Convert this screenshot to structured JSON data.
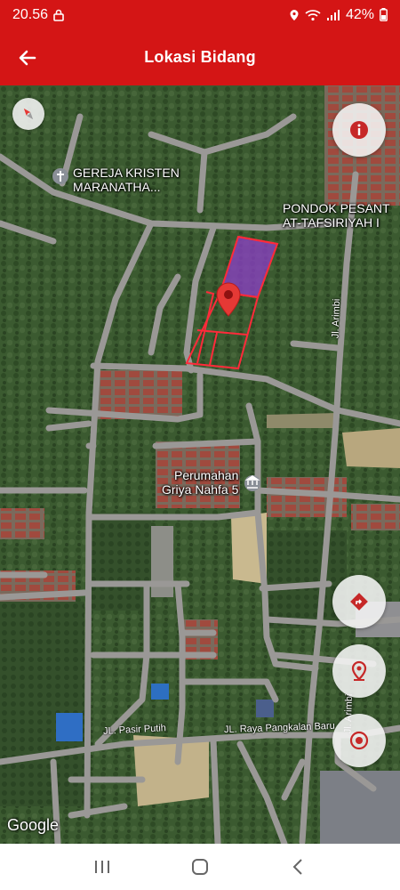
{
  "status": {
    "time": "20.56",
    "battery": "42%"
  },
  "app_bar": {
    "title": "Lokasi Bidang"
  },
  "map": {
    "labels": {
      "church_line1": "GEREJA KRISTEN",
      "church_line2": "MARANATHA...",
      "pondok_line1": "PONDOK PESANT",
      "pondok_line2": "AT-TAFSIRIYAH I",
      "perumahan_line1": "Perumahan",
      "perumahan_line2": "Griya Nahfa 5"
    },
    "roads": {
      "arimbi_top": "Jl. Arimbi",
      "arimbi_bottom": "Jl. Arimbi",
      "pasir_putih": "JL. Pasir Putih",
      "pangkalan_baru": "JL. Raya Pangkalan Baru"
    },
    "attribution": "Google",
    "parcel_color": "#8a3fc4",
    "marker_color": "#e53935"
  },
  "colors": {
    "brand": "#d41515"
  }
}
